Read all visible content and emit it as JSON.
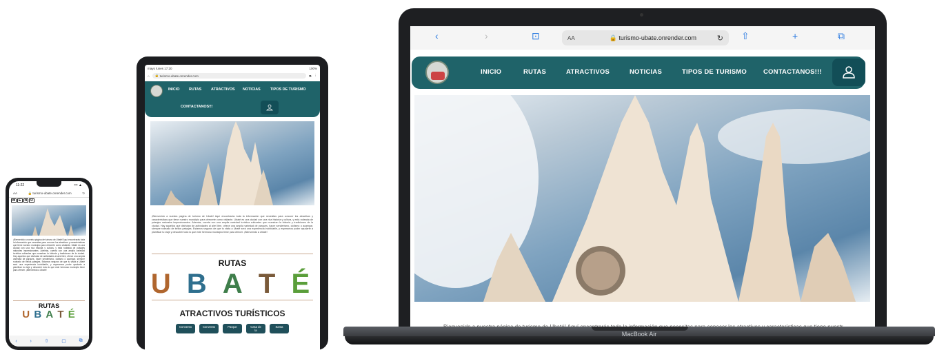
{
  "phone": {
    "time": "11:22",
    "signal": "••• ▲",
    "url_left": "AA",
    "url": "turismo-ubate.onrender.com",
    "menu": [
      "M",
      "E",
      "N",
      "U"
    ],
    "intro": "¡Bienvenido a nuestra página de turismo de Ubaté! Aquí encontrarás toda la información que necesitas para conocer los atractivos y características que tiene nuestro municipio para ofrecerte como visitante. Ubaté es una ciudad con una rica historia y cultura, y está rodeada de paisajes naturales impresionantes. Además, cuenta con una amplia variedad turística culturales que muestran la historia y tradiciones de la ciudad. Hay aquellos que disfrutan de actividades al aire libre, ofrece una amplia variedad de parques, hacer senderismo, ciclismo o acampar, siempre rodeado de bellos paisajes. Estamos seguros de que tu visita a Ubaté será una experiencia inolvidable, y esperamos poder ayudarte a planificar tu viaje y descubrir todo lo que este hermoso municipio tiene para ofrecer. ¡Bienvenido a Ubaté!",
    "rutas_title": "RUTAS",
    "ubate_letters": [
      "U",
      "B",
      "A",
      "T",
      "É"
    ],
    "toolbar": [
      "‹",
      "›",
      "⇧",
      "▢",
      "⧉"
    ]
  },
  "tablet": {
    "status_left": "mayo lunes 17:20",
    "status_right": "100%",
    "url": "turismo-ubate.onrender.com",
    "nav": [
      "INICIO",
      "RUTAS",
      "ATRACTIVOS",
      "NOTICIAS",
      "TIPOS DE TURISMO",
      "CONTACTANOS!!!"
    ],
    "intro": "¡Bienvenido a nuestra página de turismo de Ubaté! Aquí encontrarás toda la información que necesitas para conocer los atractivos y características que tiene nuestro municipio para ofrecerte como visitante. Ubaté es una ciudad con una rica historia y cultura, y está rodeada de paisajes naturales impresionantes. Además, cuenta con una amplia variedad turística culturales que muestran la historia y tradiciones de la ciudad. Hay aquellos que disfrutan de actividades al aire libre, ofrece una amplia variedad de parques, hacer senderismo, ciclismo o acampar, siempre rodeado de bellos paisajes. Estamos seguros de que tu visita a Ubaté será una experiencia inolvidable, y esperamos poder ayudarte a planificar tu viaje y descubrir todo lo que este hermoso municipio tiene para ofrecer. ¡Bienvenido a Ubaté!",
    "rutas_title": "RUTAS",
    "ubate_letters": [
      "U",
      "B",
      "A",
      "T",
      "É"
    ],
    "atractivos_title": "ATRACTIVOS TURÍSTICOS",
    "attraction_buttons": [
      "Convento",
      "Convento",
      "Parque",
      "Casa de la",
      "Santa"
    ]
  },
  "laptop": {
    "safari": {
      "back": "‹",
      "forward": "›",
      "book": "⊡",
      "aa": "AA",
      "url": "turismo-ubate.onrender.com",
      "reload": "↻",
      "share": "⇧",
      "plus": "+",
      "tabs": "⧉"
    },
    "nav": [
      "INICIO",
      "RUTAS",
      "ATRACTIVOS",
      "NOTICIAS",
      "TIPOS DE TURISMO",
      "CONTACTANOS!!!"
    ],
    "intro_line": "Bienvenido a nuestra página de turismo de Ubaté! Aquí encontrarás toda la información que necesitas para conocer los atractivos y características que tiene nuestro",
    "device_label": "MacBook Air"
  },
  "colors": {
    "nav_teal": "#1f6369",
    "user_button": "#124e57",
    "divider": "#c9a88f"
  }
}
